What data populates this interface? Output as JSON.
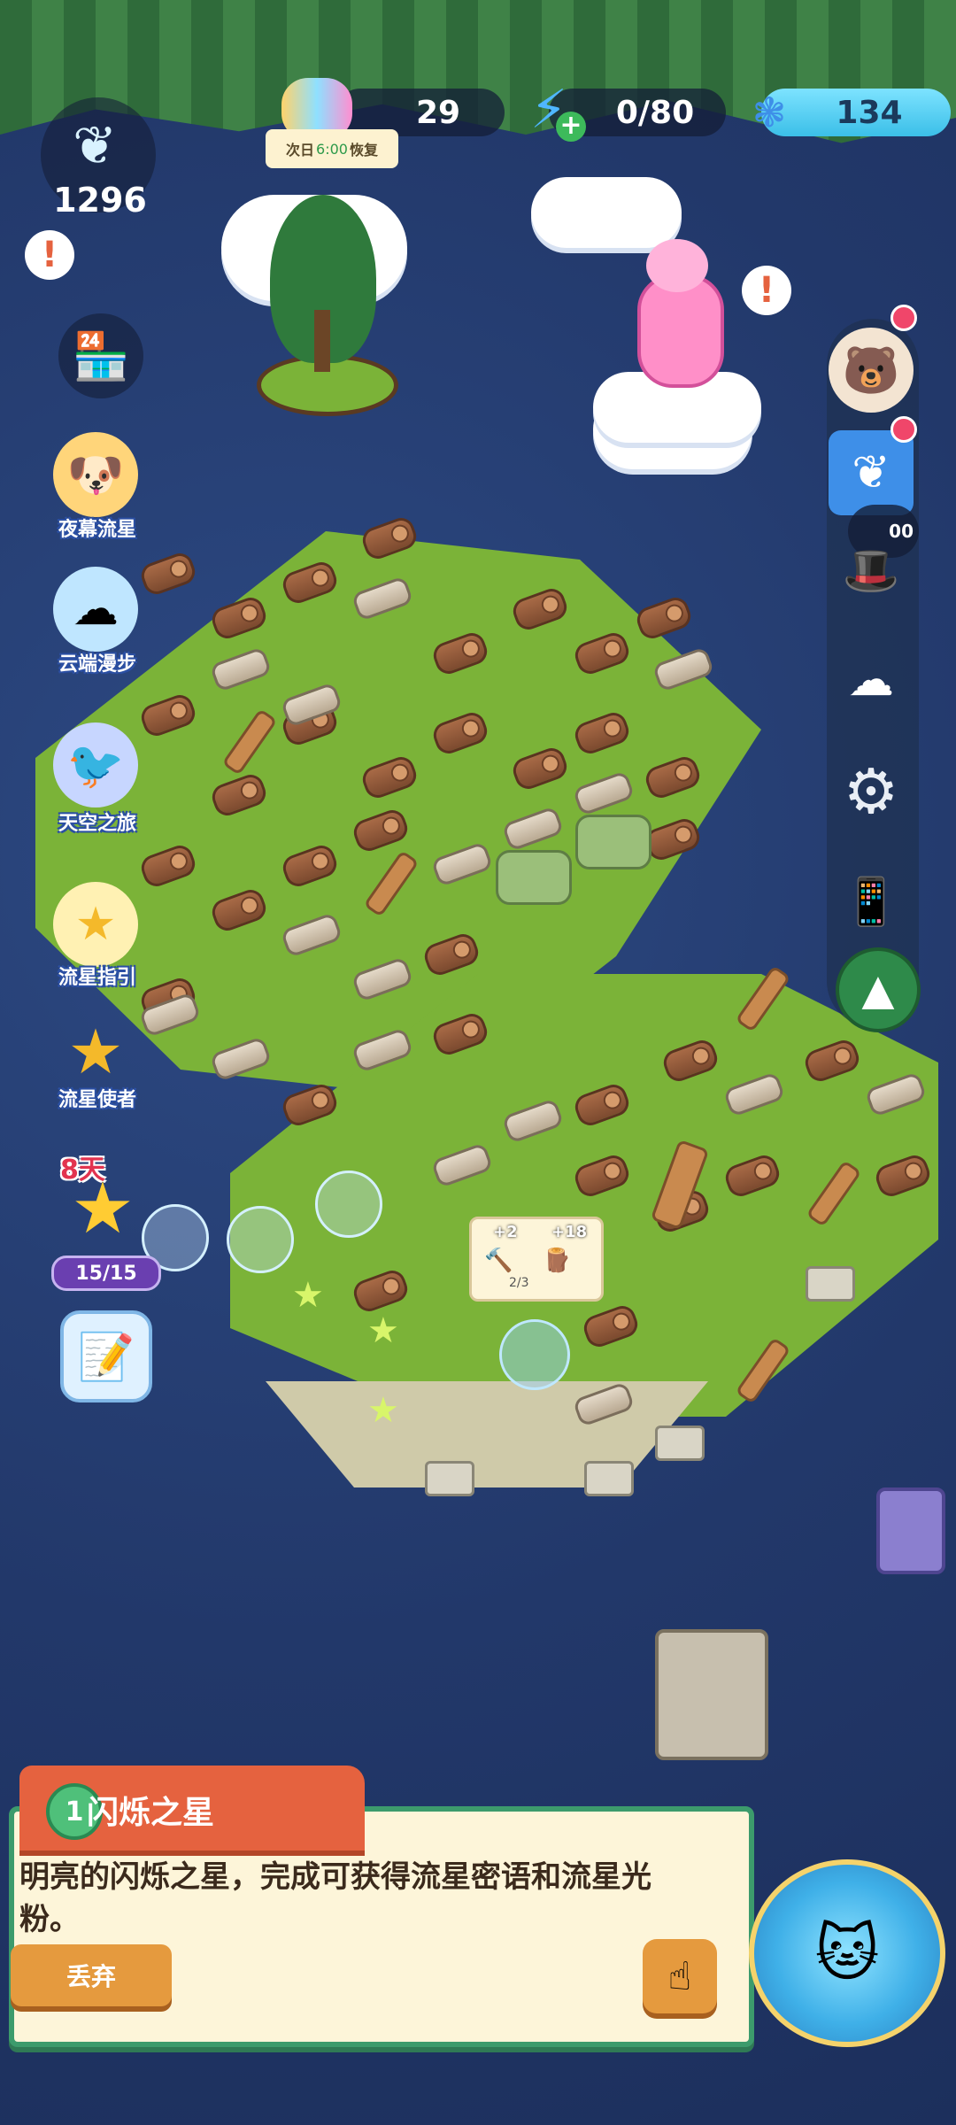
{
  "hud": {
    "feather_count": "1296",
    "energy_count": "29",
    "energy_restore_note": {
      "prefix": "次日",
      "time": "6:00",
      "suffix": "恢复"
    },
    "lightning_count": "0/80",
    "gem_count": "134"
  },
  "left_menu": {
    "items": [
      {
        "label": "夜幕流星",
        "icon": "dog-cloud-icon"
      },
      {
        "label": "云端漫步",
        "icon": "cloud-creature-icon"
      },
      {
        "label": "天空之旅",
        "icon": "bird-icon"
      },
      {
        "label": "流星指引",
        "icon": "shooting-star-icon"
      },
      {
        "label": "流星使者",
        "icon": "star-messenger-icon"
      }
    ],
    "event_days": "8天",
    "event_progress": "15/15"
  },
  "merge_card": {
    "reward_a": "+2",
    "reward_b": "+18",
    "count": "2/3"
  },
  "quest": {
    "number": "1",
    "title": "闪烁之星",
    "description": "明亮的闪烁之星，完成可获得流星密语和流星光粉。",
    "discard_label": "丢弃"
  },
  "right_menu": {
    "timer_partial": "00"
  },
  "colors": {
    "quest_tab": "#e5623f",
    "quest_border": "#3c9b6c",
    "grass": "#7bb338",
    "night_sky": "#243a6b"
  }
}
